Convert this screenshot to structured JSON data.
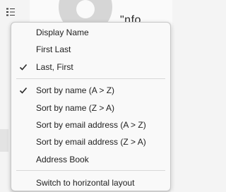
{
  "background": {
    "heading_text": "\"nfo"
  },
  "menu": {
    "groups": [
      [
        {
          "label": "Display Name",
          "checked": false
        },
        {
          "label": "First Last",
          "checked": false
        },
        {
          "label": "Last, First",
          "checked": true
        }
      ],
      [
        {
          "label": "Sort by name (A > Z)",
          "checked": true
        },
        {
          "label": "Sort by name (Z > A)",
          "checked": false
        },
        {
          "label": "Sort by email address (A > Z)",
          "checked": false
        },
        {
          "label": "Sort by email address (Z > A)",
          "checked": false
        },
        {
          "label": "Address Book",
          "checked": false
        }
      ],
      [
        {
          "label": "Switch to horizontal layout",
          "checked": false
        }
      ]
    ]
  },
  "icons": {
    "toolbar_button": "list-options-icon",
    "checked_mark": "checkmark-icon"
  },
  "colors": {
    "menu_bg": "#f9f9f9",
    "text": "#1e1e1e",
    "separator": "#d8d8d8"
  }
}
